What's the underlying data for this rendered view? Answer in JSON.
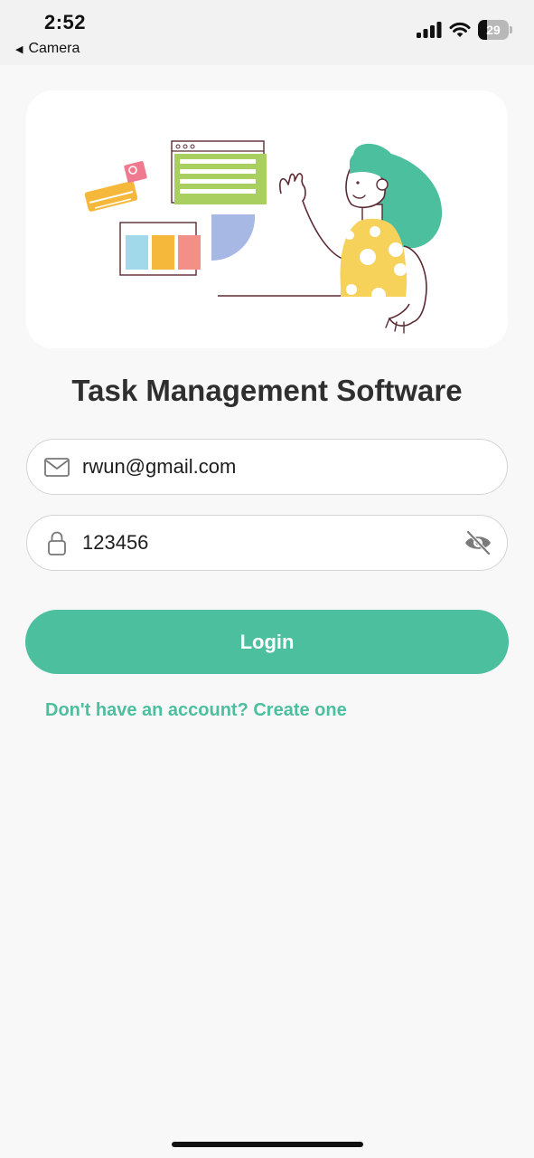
{
  "status_bar": {
    "time": "2:52",
    "back_label": "Camera",
    "battery_level": "29",
    "battery_fraction": 0.29
  },
  "hero": {
    "illustration": "woman-waving-task-board-illustration"
  },
  "app_title": "Task Management Software",
  "form": {
    "email": {
      "icon": "mail-icon",
      "value": "rwun@gmail.com"
    },
    "password": {
      "icon": "lock-icon",
      "value": "123456",
      "toggle_icon": "eye-off-icon"
    },
    "login_label": "Login",
    "signup_link": "Don't have an account? Create one"
  },
  "colors": {
    "accent": "#4bbf9e",
    "background": "#f8f8f8",
    "card": "#ffffff",
    "title_text": "#2f2f2f"
  }
}
